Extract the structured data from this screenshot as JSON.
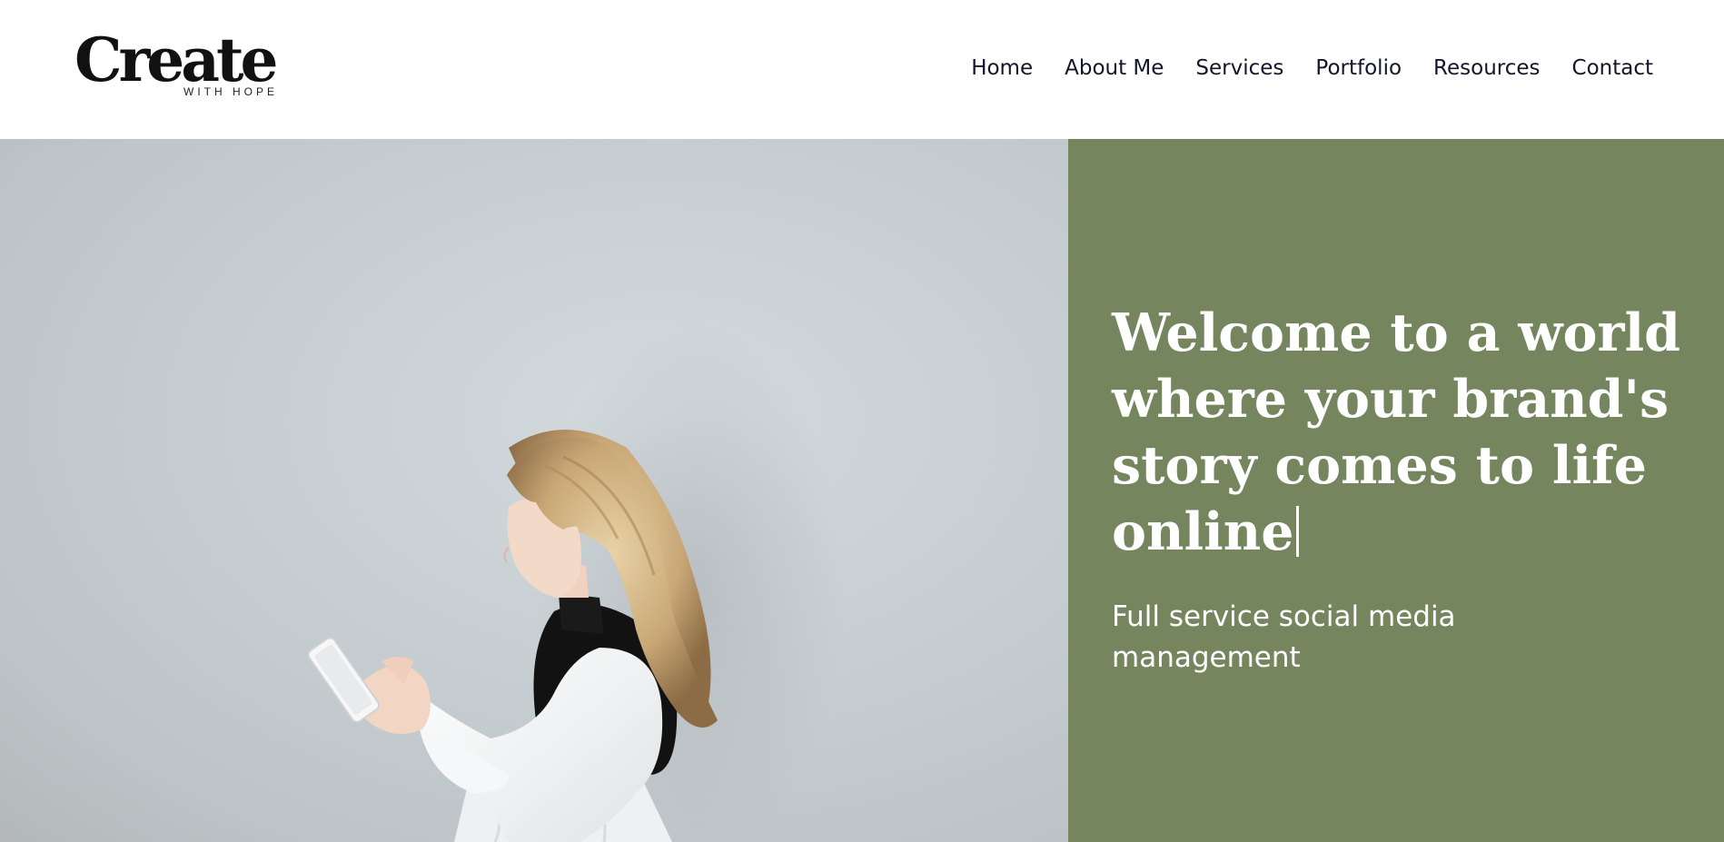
{
  "brand": {
    "logo_main": "Create",
    "logo_sub": "WITH HOPE"
  },
  "nav": {
    "items": [
      {
        "label": "Home"
      },
      {
        "label": "About Me"
      },
      {
        "label": "Services"
      },
      {
        "label": "Portfolio"
      },
      {
        "label": "Resources"
      },
      {
        "label": "Contact"
      }
    ]
  },
  "hero": {
    "headline": "Welcome to a world where your brand's story comes to life online",
    "subline": "Full service social media management",
    "photo_alt": "woman in white blouse and black vest looking at phone",
    "panel_color": "#75855e"
  }
}
